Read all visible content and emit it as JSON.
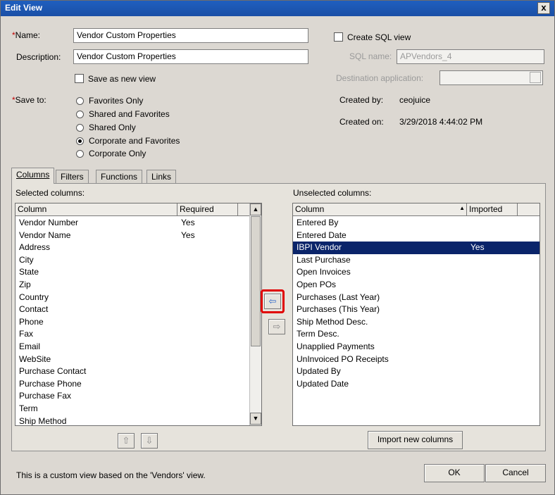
{
  "window": {
    "title": "Edit View",
    "close_glyph": "x"
  },
  "form": {
    "name_label": "Name:",
    "name_value": "Vendor Custom Properties",
    "description_label": "Description:",
    "description_value": "Vendor Custom Properties",
    "save_as_new_label": "Save as new view",
    "save_to_label": "Save to:",
    "save_options": [
      {
        "label": "Favorites Only",
        "selected": false
      },
      {
        "label": "Shared and Favorites",
        "selected": false
      },
      {
        "label": "Shared Only",
        "selected": false
      },
      {
        "label": "Corporate and Favorites",
        "selected": true
      },
      {
        "label": "Corporate Only",
        "selected": false
      }
    ],
    "create_sql_label": "Create SQL view",
    "sql_name_label": "SQL name:",
    "sql_name_value": "APVendors_4",
    "destination_label": "Destination application:",
    "created_by_label": "Created by:",
    "created_by_value": "ceojuice",
    "created_on_label": "Created on:",
    "created_on_value": "3/29/2018 4:44:02 PM"
  },
  "tabs": [
    "Columns",
    "Filters",
    "Functions",
    "Links"
  ],
  "selected": {
    "label": "Selected columns:",
    "headers": [
      "Column",
      "Required"
    ],
    "rows": [
      [
        "Vendor Number",
        "Yes"
      ],
      [
        "Vendor Name",
        "Yes"
      ],
      [
        "Address",
        ""
      ],
      [
        "City",
        ""
      ],
      [
        "State",
        ""
      ],
      [
        "Zip",
        ""
      ],
      [
        "Country",
        ""
      ],
      [
        "Contact",
        ""
      ],
      [
        "Phone",
        ""
      ],
      [
        "Fax",
        ""
      ],
      [
        "Email",
        ""
      ],
      [
        "WebSite",
        ""
      ],
      [
        "Purchase Contact",
        ""
      ],
      [
        "Purchase Phone",
        ""
      ],
      [
        "Purchase Fax",
        ""
      ],
      [
        "Term",
        ""
      ],
      [
        "Ship Method",
        ""
      ]
    ]
  },
  "unselected": {
    "label": "Unselected columns:",
    "headers": [
      "Column",
      "Imported"
    ],
    "rows": [
      [
        "Entered By",
        ""
      ],
      [
        "Entered Date",
        ""
      ],
      [
        "IBPI Vendor",
        "Yes"
      ],
      [
        "Last Purchase",
        ""
      ],
      [
        "Open Invoices",
        ""
      ],
      [
        "Open POs",
        ""
      ],
      [
        "Purchases (Last Year)",
        ""
      ],
      [
        "Purchases (This Year)",
        ""
      ],
      [
        "Ship Method Desc.",
        ""
      ],
      [
        "Term Desc.",
        ""
      ],
      [
        "Unapplied Payments",
        ""
      ],
      [
        "UnInvoiced PO Receipts",
        ""
      ],
      [
        "Updated By",
        ""
      ],
      [
        "Updated Date",
        ""
      ]
    ],
    "selected_row": 2
  },
  "buttons": {
    "import_new": "Import new columns",
    "ok": "OK",
    "cancel": "Cancel",
    "move_left_glyph": "⇦",
    "move_right_glyph": "⇨",
    "move_up_glyph": "⇧",
    "move_down_glyph": "⇩",
    "scroll_up_glyph": "▲",
    "scroll_down_glyph": "▼",
    "sort_glyph": "▲"
  },
  "footer_text": "This is a custom view based on the 'Vendors' view.",
  "colors": {
    "titlebar": "#1f5fbf",
    "selection": "#0a246a",
    "highlight": "#e00000",
    "required": "#c00000"
  }
}
